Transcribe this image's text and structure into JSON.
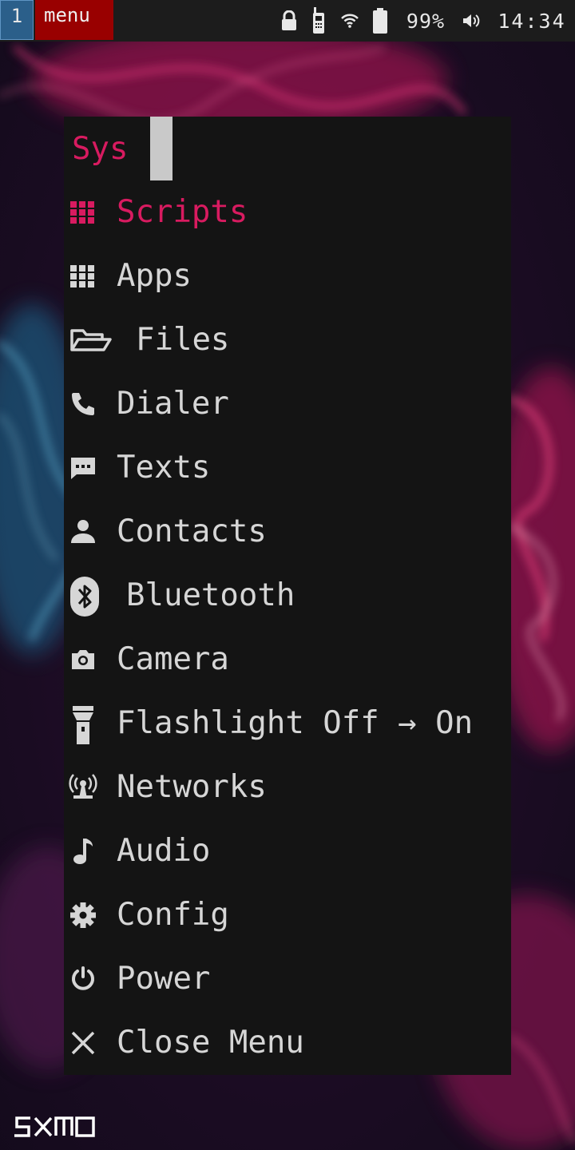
{
  "topbar": {
    "workspace": "1",
    "menu_tag": "menu",
    "icons": [
      "lock-icon",
      "phone-signal-icon",
      "wifi-icon",
      "battery-icon",
      "volume-icon"
    ],
    "battery": "99%",
    "time": "14:34"
  },
  "menu": {
    "prompt": "Sys",
    "items": [
      {
        "label": "Scripts",
        "icon": "grid-icon",
        "selected": true
      },
      {
        "label": "Apps",
        "icon": "grid-icon"
      },
      {
        "label": "Files",
        "icon": "folder-open-icon"
      },
      {
        "label": "Dialer",
        "icon": "phone-icon"
      },
      {
        "label": "Texts",
        "icon": "message-icon"
      },
      {
        "label": "Contacts",
        "icon": "person-icon"
      },
      {
        "label": "Bluetooth",
        "icon": "bluetooth-icon"
      },
      {
        "label": "Camera",
        "icon": "camera-icon"
      },
      {
        "label": "Flashlight Off → On",
        "icon": "flashlight-icon"
      },
      {
        "label": "Networks",
        "icon": "antenna-icon"
      },
      {
        "label": "Audio",
        "icon": "music-note-icon"
      },
      {
        "label": "Config",
        "icon": "gear-icon"
      },
      {
        "label": "Power",
        "icon": "power-icon"
      },
      {
        "label": "Close Menu",
        "icon": "close-icon"
      }
    ]
  },
  "logo": "SXMO",
  "colors": {
    "accent": "#d81b60",
    "menu_bg": "#141414",
    "menu_text": "#d6d6d6",
    "workspace_bg": "#2b5f8a",
    "menu_tag_bg": "#990000",
    "topbar_bg": "#1c1c1c"
  }
}
